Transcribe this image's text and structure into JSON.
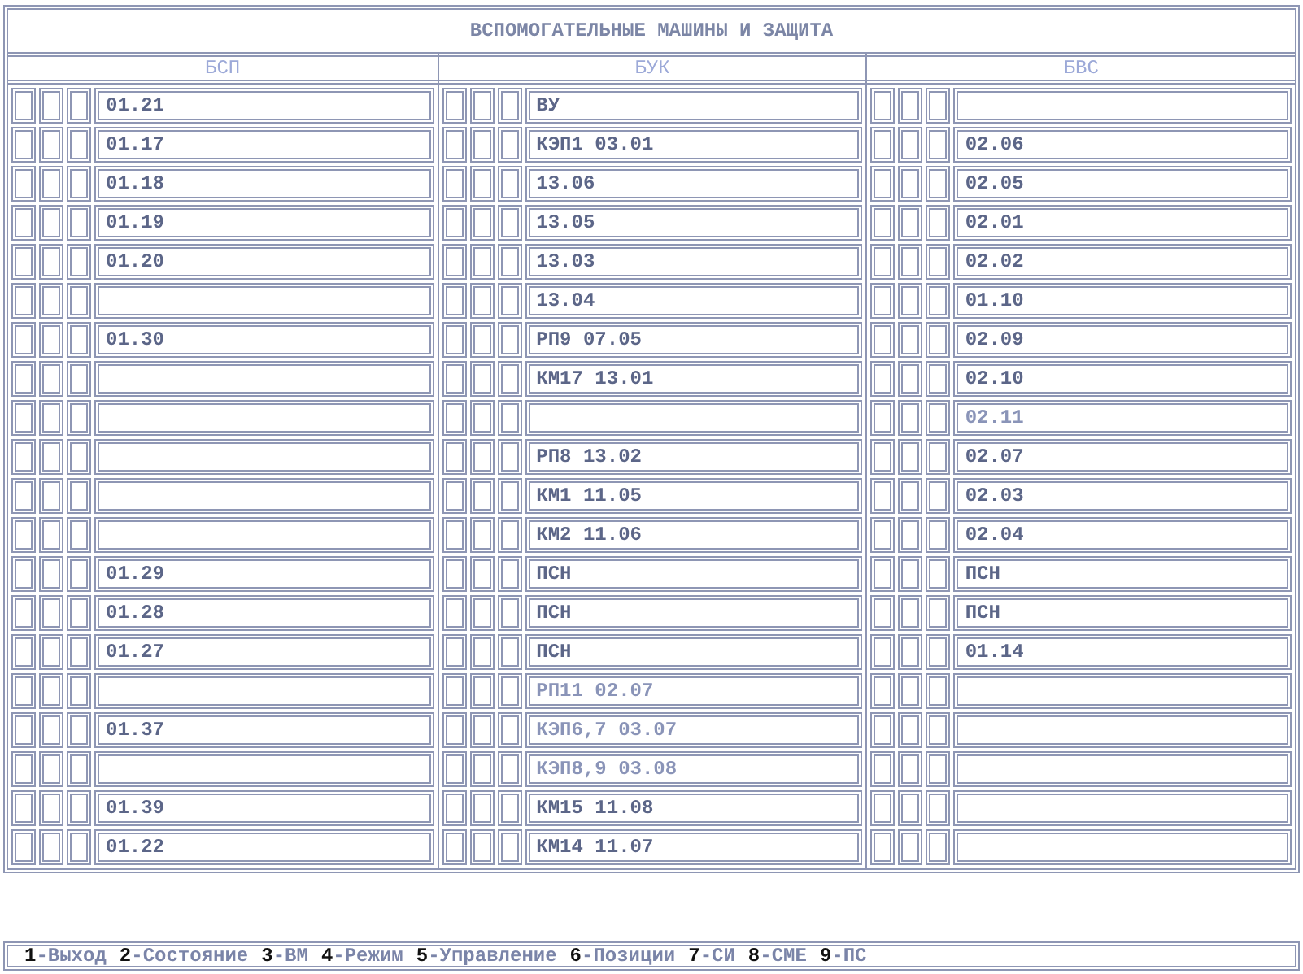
{
  "title": "ВСПОМОГАТЕЛЬНЫЕ МАШИНЫ И ЗАЩИТА",
  "groups": [
    {
      "heading": "БСП",
      "rows": [
        {
          "label": "01.21"
        },
        {
          "label": "01.17"
        },
        {
          "label": "01.18"
        },
        {
          "label": "01.19"
        },
        {
          "label": "01.20"
        },
        {},
        {
          "label": "01.30"
        },
        {},
        {},
        {},
        {},
        {},
        {
          "label": "01.29"
        },
        {
          "label": "01.28"
        },
        {
          "label": "01.27"
        },
        {},
        {
          "label": "01.37"
        },
        {},
        {
          "label": "01.39"
        },
        {
          "label": "01.22"
        }
      ]
    },
    {
      "heading": "БУК",
      "rows": [
        {
          "label": "ВУ"
        },
        {
          "label": "КЭП1 03.01"
        },
        {
          "label": "13.06"
        },
        {
          "label": "13.05"
        },
        {
          "label": "13.03"
        },
        {
          "label": "13.04"
        },
        {
          "label": "РП9 07.05"
        },
        {
          "label": "КМ17 13.01"
        },
        {},
        {
          "label": "РП8 13.02"
        },
        {
          "label": "КМ1 11.05"
        },
        {
          "label": "КМ2 11.06"
        },
        {
          "label": "ПСН"
        },
        {
          "label": "ПСН"
        },
        {
          "label": "ПСН"
        },
        {
          "label": "РП11 02.07",
          "dim": true
        },
        {
          "label": "КЭП6,7 03.07",
          "dim": true
        },
        {
          "label": "КЭП8,9 03.08",
          "dim": true
        },
        {
          "label": "КМ15 11.08"
        },
        {
          "label": "КМ14 11.07"
        }
      ]
    },
    {
      "heading": "БВС",
      "rows": [
        {},
        {
          "label": "02.06"
        },
        {
          "label": "02.05"
        },
        {
          "label": "02.01"
        },
        {
          "label": "02.02"
        },
        {
          "label": "01.10"
        },
        {
          "label": "02.09"
        },
        {
          "label": "02.10"
        },
        {
          "label": "02.11",
          "dim": true
        },
        {
          "label": "02.07"
        },
        {
          "label": "02.03"
        },
        {
          "label": "02.04"
        },
        {
          "label": "ПСН"
        },
        {
          "label": "ПСН"
        },
        {
          "label": "01.14"
        },
        {},
        {},
        {},
        {},
        {}
      ]
    }
  ],
  "keys": [
    {
      "key": "1",
      "label": "-Выход"
    },
    {
      "key": "2",
      "label": "-Состояние"
    },
    {
      "key": "3",
      "label": "-ВМ"
    },
    {
      "key": "4",
      "label": "-Режим"
    },
    {
      "key": "5",
      "label": "-Управление"
    },
    {
      "key": "6",
      "label": "-Позиции"
    },
    {
      "key": "7",
      "label": "-СИ"
    },
    {
      "key": "8",
      "label": "-СМЕ"
    },
    {
      "key": "9",
      "label": "-ПС"
    }
  ]
}
